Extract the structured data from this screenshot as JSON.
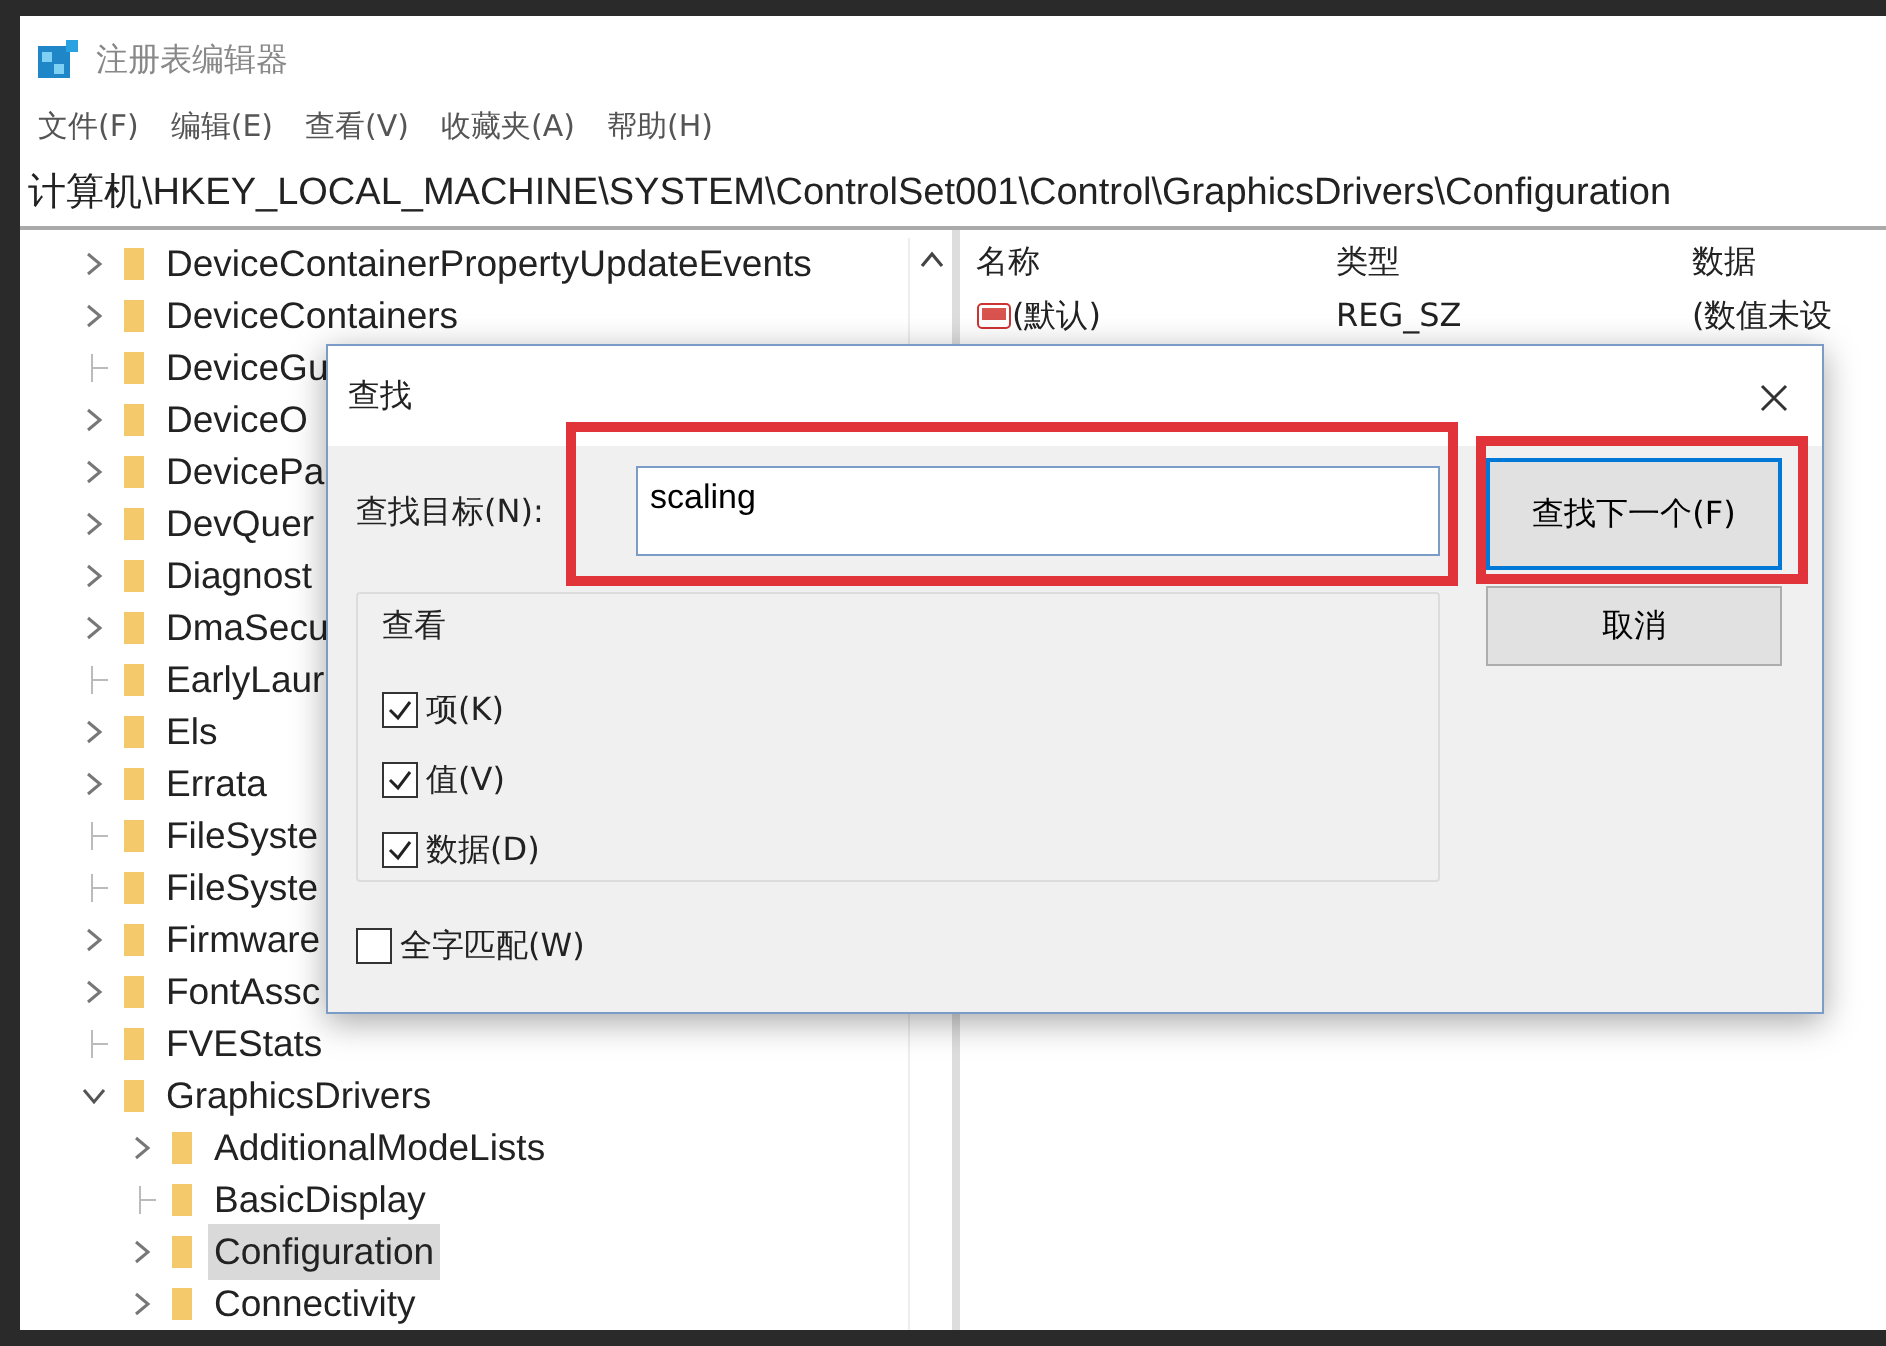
{
  "window": {
    "title": "注册表编辑器"
  },
  "menu": [
    {
      "label": "文件(F)"
    },
    {
      "label": "编辑(E)"
    },
    {
      "label": "查看(V)"
    },
    {
      "label": "收藏夹(A)"
    },
    {
      "label": "帮助(H)"
    }
  ],
  "address": "计算机\\HKEY_LOCAL_MACHINE\\SYSTEM\\ControlSet001\\Control\\GraphicsDrivers\\Configuration",
  "tree": [
    {
      "label": "DeviceContainerPropertyUpdateEvents",
      "kind": "collapsed",
      "selected": false
    },
    {
      "label": "DeviceContainers",
      "kind": "collapsed",
      "selected": false
    },
    {
      "label": "DeviceGu",
      "kind": "leaf",
      "selected": false
    },
    {
      "label": "DeviceO",
      "kind": "collapsed",
      "selected": false
    },
    {
      "label": "DevicePa",
      "kind": "collapsed",
      "selected": false
    },
    {
      "label": "DevQuer",
      "kind": "collapsed",
      "selected": false
    },
    {
      "label": "Diagnost",
      "kind": "collapsed",
      "selected": false
    },
    {
      "label": "DmaSecu",
      "kind": "collapsed",
      "selected": false
    },
    {
      "label": "EarlyLaur",
      "kind": "leaf",
      "selected": false
    },
    {
      "label": "Els",
      "kind": "collapsed",
      "selected": false
    },
    {
      "label": "Errata",
      "kind": "collapsed",
      "selected": false
    },
    {
      "label": "FileSyste",
      "kind": "leaf",
      "selected": false
    },
    {
      "label": "FileSyste",
      "kind": "leaf",
      "selected": false
    },
    {
      "label": "Firmware",
      "kind": "collapsed",
      "selected": false
    },
    {
      "label": "FontAssc",
      "kind": "collapsed",
      "selected": false
    },
    {
      "label": "FVEStats",
      "kind": "leaf",
      "selected": false
    },
    {
      "label": "GraphicsDrivers",
      "kind": "expanded",
      "selected": false,
      "children": [
        {
          "label": "AdditionalModeLists",
          "kind": "collapsed",
          "selected": false
        },
        {
          "label": "BasicDisplay",
          "kind": "leaf",
          "selected": false
        },
        {
          "label": "Configuration",
          "kind": "collapsed",
          "selected": true
        },
        {
          "label": "Connectivity",
          "kind": "collapsed",
          "selected": false
        }
      ]
    }
  ],
  "values": {
    "columns": [
      "名称",
      "类型",
      "数据"
    ],
    "rows": [
      {
        "name": "(默认)",
        "type": "REG_SZ",
        "data": "(数值未设"
      }
    ]
  },
  "dialog": {
    "title": "查找",
    "target_label": "查找目标(N):",
    "target_value": "scaling",
    "target_highlighted": true,
    "group_title": "查看",
    "options": [
      {
        "label": "项(K)",
        "checked": true
      },
      {
        "label": "值(V)",
        "checked": true
      },
      {
        "label": "数据(D)",
        "checked": true
      }
    ],
    "whole_word": {
      "label": "全字匹配(W)",
      "checked": false
    },
    "buttons": [
      {
        "label": "查找下一个(F)",
        "default": true,
        "highlighted": true
      },
      {
        "label": "取消",
        "default": false,
        "highlighted": false
      }
    ]
  }
}
